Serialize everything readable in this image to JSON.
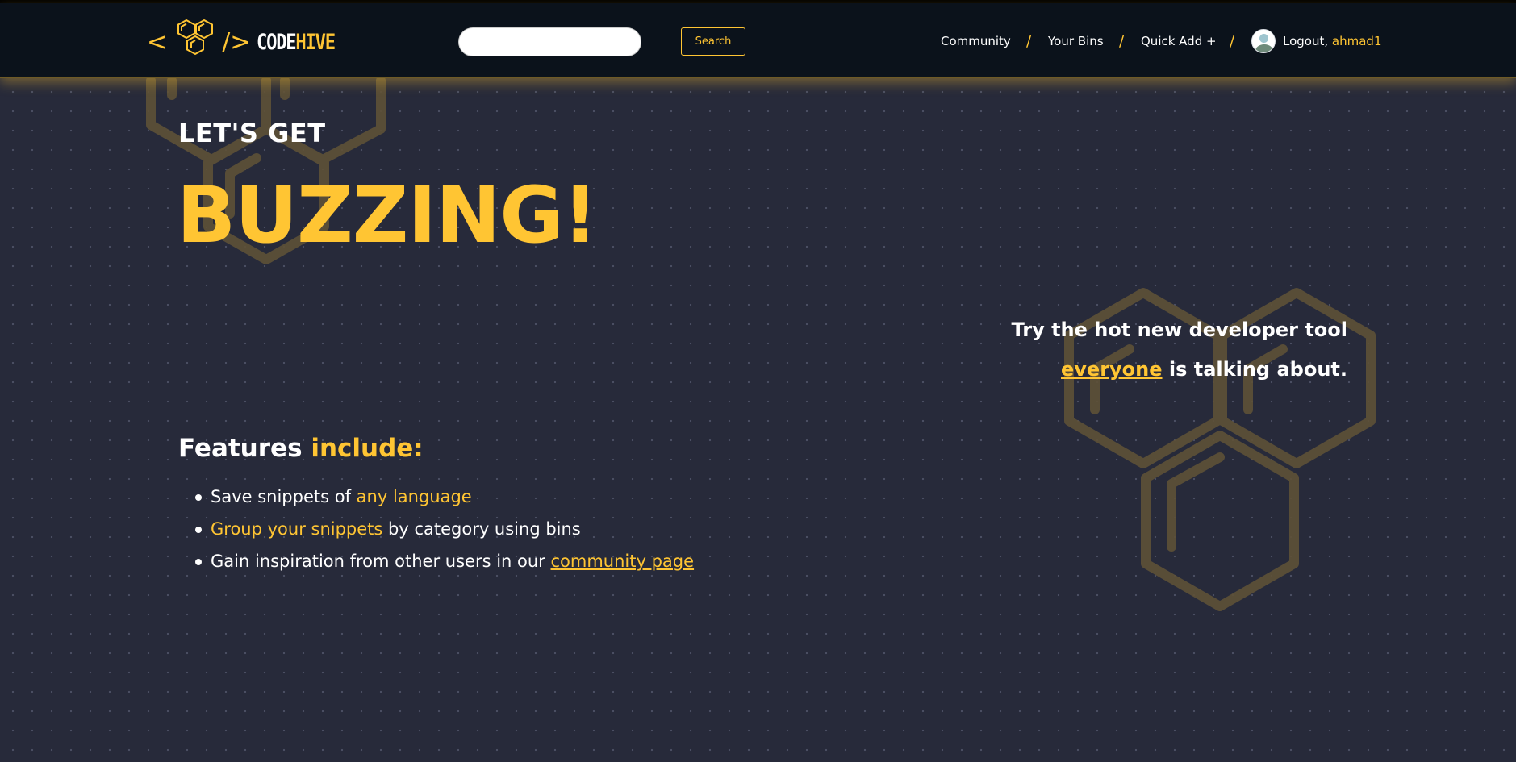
{
  "header": {
    "logo": {
      "bracket_left": "<",
      "bracket_right": "/>",
      "word1": "CODE",
      "word2": "HIVE"
    },
    "search": {
      "value": "",
      "placeholder": "",
      "button_label": "Search"
    },
    "nav": {
      "community": "Community",
      "your_bins": "Your Bins",
      "quick_add": "Quick Add +",
      "separator": "/"
    },
    "user": {
      "avatar_icon": "user-avatar",
      "logout_label": "Logout,",
      "username": "ahmad1"
    }
  },
  "hero": {
    "eyebrow": "LET'S GET",
    "headline": "BUZZING!",
    "tagline_line1": "Try the hot new developer tool",
    "tagline_link": "everyone",
    "tagline_rest": " is talking about."
  },
  "features": {
    "title_white": "Features ",
    "title_accent": "include:",
    "items": [
      {
        "pre": "Save snippets of ",
        "accent": "any language",
        "post": ""
      },
      {
        "pre": "",
        "accent": "Group your snippets",
        "post": " by category using bins"
      },
      {
        "pre": "Gain inspiration from other users in our ",
        "link": "community page"
      }
    ]
  },
  "colors": {
    "accent": "#ffc533",
    "background": "#272a3a",
    "header": "#0b121b",
    "hex_watermark": "#5e5137"
  },
  "icons": [
    "hive-logo-icon",
    "honeycomb-watermark-icon",
    "user-avatar-icon"
  ]
}
